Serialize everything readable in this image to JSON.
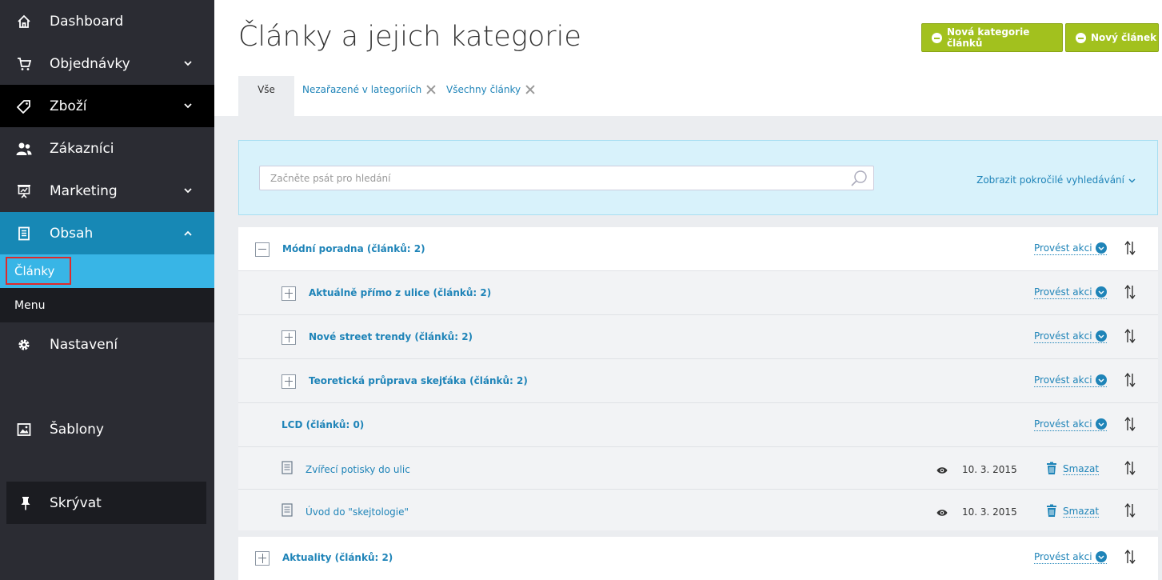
{
  "sidebar": {
    "items": [
      {
        "label": "Dashboard",
        "icon": "home-icon"
      },
      {
        "label": "Objednávky",
        "icon": "cart-icon"
      },
      {
        "label": "Zboží",
        "icon": "tag-icon"
      },
      {
        "label": "Zákazníci",
        "icon": "users-icon"
      },
      {
        "label": "Marketing",
        "icon": "presentation-icon"
      },
      {
        "label": "Obsah",
        "icon": "book-icon"
      },
      {
        "label": "Nastavení",
        "icon": "gear-icon"
      },
      {
        "label": "Šablony",
        "icon": "image-icon"
      }
    ],
    "sub_items": [
      {
        "label": "Články",
        "active": true
      },
      {
        "label": "Menu",
        "active": false
      }
    ],
    "hide_label": "Skrývat"
  },
  "header": {
    "title": "Články a jejich kategorie",
    "new_category_button": "Nová kategorie článků",
    "new_article_button": "Nový článek",
    "tabs": [
      {
        "label": "Vše",
        "active": true
      },
      {
        "label": "Nezařazené v lategoriích",
        "active": false
      },
      {
        "label": "Všechny články",
        "active": false
      }
    ]
  },
  "search": {
    "placeholder": "Začněte psát pro hledání",
    "advanced_label": "Zobrazit pokročilé vyhledávání"
  },
  "tree": {
    "action_label": "Provést akci",
    "delete_label": "Smazat",
    "rows": [
      {
        "type": "category",
        "label": "Módní poradna (článků: 2)",
        "level": 0,
        "expanded": true
      },
      {
        "type": "category",
        "label": "Aktuálně přímo z ulice (článků: 2)",
        "level": 1,
        "expanded": false
      },
      {
        "type": "category",
        "label": "Nové street trendy (článků: 2)",
        "level": 1,
        "expanded": false
      },
      {
        "type": "category",
        "label": "Teoretická průprava skejťáka (článků: 2)",
        "level": 1,
        "expanded": false
      },
      {
        "type": "category",
        "label": "LCD (článků: 0)",
        "level": 1,
        "expanded": null
      },
      {
        "type": "article",
        "label": "Zvířecí potisky do ulic",
        "date": "10. 3. 2015"
      },
      {
        "type": "article",
        "label": "Úvod do \"skejtologie\"",
        "date": "10. 3. 2015"
      },
      {
        "type": "category",
        "label": "Aktuality (článků: 2)",
        "level": 0,
        "expanded": false
      }
    ]
  },
  "colors": {
    "sidebar_bg": "#2b2c33",
    "sidebar_active_bg": "#1788b5",
    "sub_active_bg": "#38b5e6",
    "accent_green": "#a2c11e",
    "link_blue": "#1f84b8",
    "highlight_red": "#e02a2a"
  }
}
